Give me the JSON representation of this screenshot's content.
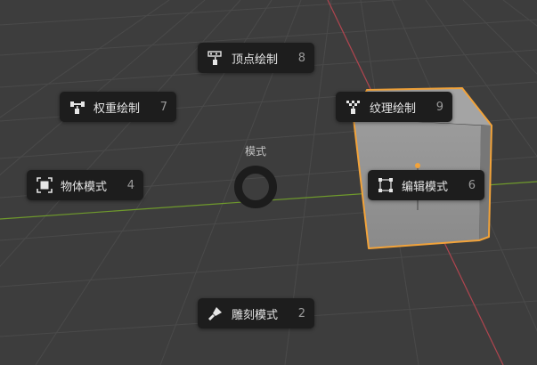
{
  "pie_menu": {
    "title": "模式",
    "items": [
      {
        "label": "顶点绘制",
        "key": "8",
        "icon": "vertex-paint-icon"
      },
      {
        "label": "权重绘制",
        "key": "7",
        "icon": "weight-paint-icon"
      },
      {
        "label": "纹理绘制",
        "key": "9",
        "icon": "texture-paint-icon"
      },
      {
        "label": "物体模式",
        "key": "4",
        "icon": "object-mode-icon"
      },
      {
        "label": "编辑模式",
        "key": "6",
        "icon": "edit-mode-icon"
      },
      {
        "label": "雕刻模式",
        "key": "2",
        "icon": "sculpt-mode-icon"
      }
    ]
  },
  "colors": {
    "background": "#3d3d3d",
    "menu_item": "#1d1d1d",
    "selection_outline": "#f2a33a",
    "axis_x": "#b0454f",
    "axis_y": "#6f9a2c"
  }
}
